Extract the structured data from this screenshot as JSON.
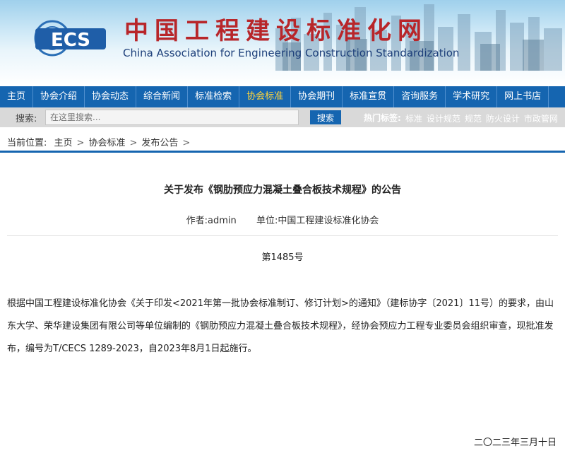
{
  "header": {
    "logo_text": "ECS",
    "title_cn": "中国工程建设标准化网",
    "title_en": "China Association for Engineering Construction Standardization"
  },
  "nav": {
    "items": [
      {
        "label": "主页"
      },
      {
        "label": "协会介绍"
      },
      {
        "label": "协会动态"
      },
      {
        "label": "综合新闻"
      },
      {
        "label": "标准检索"
      },
      {
        "label": "协会标准",
        "active": true
      },
      {
        "label": "协会期刊"
      },
      {
        "label": "标准宣贯"
      },
      {
        "label": "咨询服务"
      },
      {
        "label": "学术研究"
      },
      {
        "label": "网上书店"
      }
    ],
    "active_color": "#ffd43b",
    "bar_color": "#1565b0"
  },
  "search": {
    "label": "搜索:",
    "placeholder": "在这里搜索...",
    "button_label": "搜索",
    "hot_label": "热门标签:",
    "hot_tags": [
      "标准",
      "设计规范",
      "规范",
      "防火设计",
      "市政管网"
    ]
  },
  "breadcrumb": {
    "prefix": "当前位置:",
    "items": [
      "主页",
      "协会标准",
      "发布公告"
    ],
    "separator": ">"
  },
  "article": {
    "title": "关于发布《钢肋预应力混凝土叠合板技术规程》的公告",
    "author": "作者:admin",
    "unit": "单位:中国工程建设标准化协会",
    "number": "第1485号",
    "body": "根据中国工程建设标准化协会《关于印发<2021年第一批协会标准制订、修订计划>的通知》（建标协字〔2021〕11号）的要求，由山东大学、荣华建设集团有限公司等单位编制的《钢肋预应力混凝土叠合板技术规程》，经协会预应力工程专业委员会组织审查，现批准发布，编号为T/CECS 1289-2023，自2023年8月1日起施行。",
    "date": "二〇二三年三月十日"
  }
}
